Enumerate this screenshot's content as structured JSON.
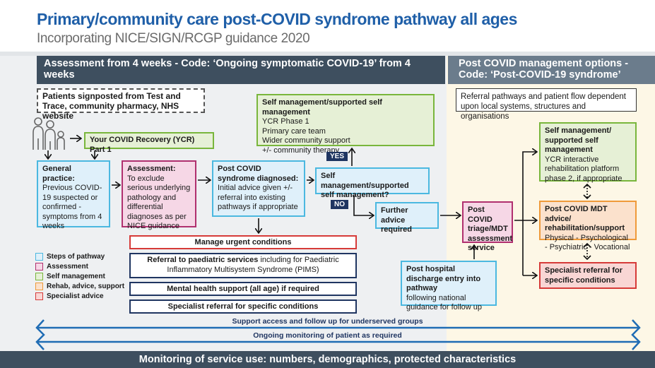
{
  "header": {
    "title": "Primary/community care post-COVID syndrome pathway all ages",
    "subtitle": "Incorporating NICE/SIGN/RCGP guidance 2020"
  },
  "sections": {
    "left_header": "Assessment from 4 weeks  - Code: ‘Ongoing symptomatic COVID-19’ from 4 weeks",
    "right_header": "Post COVID management options - Code: ‘Post-COVID-19 syndrome’"
  },
  "nodes": {
    "signposted": "Patients signposted from Test and Trace, community pharmacy, NHS website",
    "ycr_part1": "Your COVID Recovery (YCR) Part 1",
    "general_practice": {
      "title": "General practice:",
      "body": "Previous COVID-19 suspected or confirmed - symptoms from 4 weeks"
    },
    "assessment": {
      "title": "Assessment:",
      "body": "To exclude serious underlying pathology and differential diagnoses as per NICE guidance"
    },
    "diagnosed": {
      "title": "Post COVID syndrome diagnosed:",
      "body": "Initial advice given +/- referral into existing pathways if appropriate"
    },
    "self_mgmt_top": {
      "title": "Self management/supported self management",
      "lines": [
        "YCR Phase 1",
        "Primary care team",
        "Wider community support",
        "+/- community therapy"
      ]
    },
    "self_mgmt_question": "Self management/supported self management?",
    "yes_label": "YES",
    "no_label": "NO",
    "further_advice": "Further advice required",
    "triage": "Post COVID triage/MDT assessment service",
    "hospital_discharge": {
      "title": "Post hospital discharge entry into pathway",
      "body": "following national guidance for follow up"
    },
    "referral_note": "Referral pathways and patient flow dependent upon local systems, structures and organisations",
    "self_mgmt_right": {
      "title": "Self management/ supported self management",
      "body": "YCR interactive rehabilitation platform phase 2, if appropriate"
    },
    "mdt_advice": {
      "title": "Post COVID MDT advice/ rehabilitation/support",
      "body": "Physical - Psychological - Psychiatric - Vocational"
    },
    "specialist_right": "Specialist referral for specific conditions",
    "urgent": "Manage urgent conditions",
    "paediatric": {
      "title": "Referral to paediatric services",
      "body": " including for Paediatric Inflammatory Multisystem Syndrome (PIMS)"
    },
    "mental_health": "Mental health support (all age) if required",
    "specialist_left": "Specialist referral for specific conditions"
  },
  "legend": [
    {
      "label": "Steps of pathway",
      "fill": "#dff0fa",
      "stroke": "#4bb8e0"
    },
    {
      "label": "Assessment",
      "fill": "#f6d7e6",
      "stroke": "#b0306f"
    },
    {
      "label": "Self management",
      "fill": "#e6f0d6",
      "stroke": "#79b63c"
    },
    {
      "label": "Rehab, advice, support",
      "fill": "#fbe1cc",
      "stroke": "#ef9a3a"
    },
    {
      "label": "Specialist advice",
      "fill": "#f9d6d4",
      "stroke": "#d63a38"
    }
  ],
  "bands": {
    "support_access": "Support access and follow up for underserved groups",
    "ongoing_monitoring": "Ongoing monitoring of patient as required"
  },
  "footer": "Monitoring of service use: numbers, demographics, protected characteristics",
  "colors": {
    "title_blue": "#1f5fa8",
    "header_dark": "#3e4f5f",
    "header_light": "#6b7c8c",
    "navy": "#1f3561",
    "band_blue": "#1f6cb4"
  }
}
